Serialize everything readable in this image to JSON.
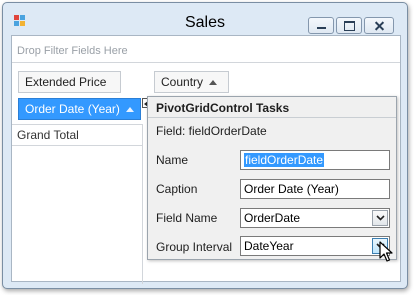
{
  "window": {
    "title": "Sales",
    "controls": {
      "minimize": "minimize",
      "maximize": "maximize",
      "close": "close"
    }
  },
  "pivot": {
    "filter_area_hint": "Drop Filter Fields Here",
    "data_field": "Extended Price",
    "column_field": "Country",
    "row_field": "Order Date (Year)",
    "grand_total_label": "Grand Total"
  },
  "tasks": {
    "title": "PivotGridControl Tasks",
    "subtitle": "Field: fieldOrderDate",
    "properties": [
      {
        "label": "Name",
        "value": "fieldOrderDate",
        "kind": "text",
        "selected": true
      },
      {
        "label": "Caption",
        "value": "Order Date (Year)",
        "kind": "text"
      },
      {
        "label": "Field Name",
        "value": "OrderDate",
        "kind": "combo"
      },
      {
        "label": "Group Interval",
        "value": "DateYear",
        "kind": "combo",
        "hover": true
      }
    ]
  },
  "colors": {
    "selection": "#3399ff",
    "window_frame": "#dde9f5",
    "panel": "#f0f0f0"
  },
  "icons": [
    "app-icon",
    "minimize-icon",
    "maximize-icon",
    "close-icon",
    "sort-ascending-icon",
    "smart-tag-icon",
    "chevron-down-icon",
    "mouse-cursor-icon"
  ]
}
